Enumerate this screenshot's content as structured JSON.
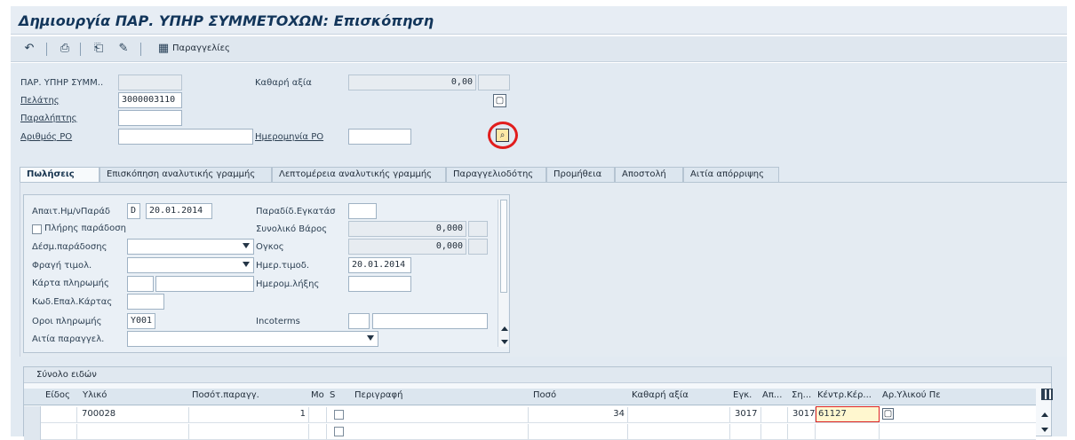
{
  "window": {
    "title": "Δημιουργία ΠΑΡ. ΥΠΗΡ ΣΥΜΜΕΤΟΧΩΝ: Επισκόπηση"
  },
  "toolbar": {
    "orders_label": "Παραγγελίες",
    "icons": [
      "back-icon",
      "print-icon",
      "display-document-icon",
      "change-document-icon",
      "table-icon"
    ]
  },
  "header": {
    "doc_type_label": "ΠΑΡ. ΥΠΗΡ ΣΥΜΜ..",
    "doc_type_value": "",
    "net_value_label": "Καθαρή αξία",
    "net_value": "0,00",
    "customer_label": "Πελάτης",
    "customer_value": "3000003110",
    "ship_to_label": "Παραλήπτης",
    "ship_to_value": "",
    "po_number_label": "Αριθμός PO",
    "po_number_value": "",
    "po_date_label": "Ημερομηνία PO",
    "po_date_value": ""
  },
  "tabs": [
    {
      "label": "Πωλήσεις"
    },
    {
      "label": "Επισκόπηση αναλυτικής γραμμής"
    },
    {
      "label": "Λεπτομέρεια αναλυτικής γραμμής"
    },
    {
      "label": "Παραγγελιοδότης"
    },
    {
      "label": "Προμήθεια"
    },
    {
      "label": "Αποστολή"
    },
    {
      "label": "Αιτία απόρριψης"
    }
  ],
  "sales": {
    "req_delivery_label": "Απαιτ.Ημ/νΠαράδ",
    "req_delivery_type": "D",
    "req_delivery_date": "20.01.2014",
    "delivering_plant_label": "Παραδίδ.Εγκατάσ",
    "delivering_plant_value": "",
    "full_delivery_label": "Πλήρης παράδοση",
    "total_weight_label": "Συνολικό Βάρος",
    "total_weight_value": "0,000",
    "delivery_block_label": "Δέσμ.παράδοσης",
    "delivery_block_value": "",
    "volume_label": "Ογκος",
    "volume_value": "0,000",
    "billing_block_label": "Φραγή τιμολ.",
    "billing_block_value": "",
    "billing_date_label": "Ημερ.τιμοδ.",
    "billing_date_value": "20.01.2014",
    "payment_card_label": "Κάρτα πληρωμής",
    "expiry_date_label": "Ημερομ.λήξης",
    "card_verification_label": "Κωδ.Επαλ.Κάρτας",
    "payment_terms_label": "Οροι πληρωμής",
    "payment_terms_value": "Y001",
    "incoterms_label": "Incoterms",
    "order_reason_label": "Αιτία παραγγελ.",
    "order_reason_value": ""
  },
  "items": {
    "title": "Σύνολο ειδών",
    "columns": [
      "Είδος",
      "Υλικό",
      "Ποσότ.παραγγ.",
      "Μο",
      "S",
      "Περιγραφή",
      "Ποσό",
      "Καθαρή αξία",
      "Εγκ.",
      "Απ...",
      "Ση...",
      "Κέντρ.Κέρ...",
      "Αρ.Υλικού Πε"
    ],
    "rows": [
      {
        "item": "",
        "material": "700028",
        "qty": "1",
        "unit": "",
        "desc": "",
        "amount": "34",
        "net": "",
        "plant": "3017",
        "aux": "",
        "ship": "3017",
        "profit_center": "61127"
      },
      {
        "item": "",
        "material": "",
        "qty": "",
        "unit": "",
        "desc": "",
        "amount": "",
        "net": "",
        "plant": "",
        "aux": "",
        "ship": "",
        "profit_center": ""
      }
    ]
  }
}
